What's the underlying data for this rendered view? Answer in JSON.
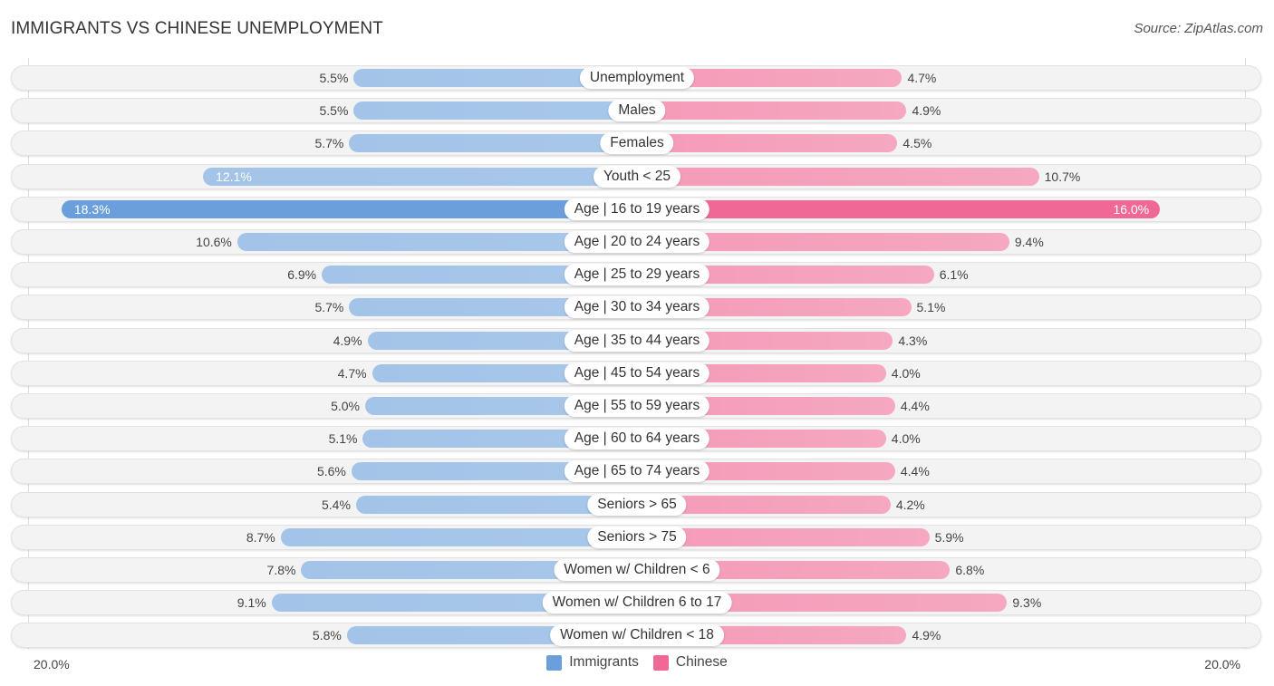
{
  "header": {
    "title": "IMMIGRANTS VS CHINESE UNEMPLOYMENT",
    "source": "Source: ZipAtlas.com"
  },
  "colors": {
    "immigrants": "#6a9fdc",
    "chinese": "#f06996",
    "immigrants_light": "#a5c5e9",
    "chinese_light": "#f5a3bd"
  },
  "chart_data": {
    "type": "bar",
    "orientation": "horizontal-diverging",
    "title": "IMMIGRANTS VS CHINESE UNEMPLOYMENT",
    "categories": [
      "Unemployment",
      "Males",
      "Females",
      "Youth < 25",
      "Age | 16 to 19 years",
      "Age | 20 to 24 years",
      "Age | 25 to 29 years",
      "Age | 30 to 34 years",
      "Age | 35 to 44 years",
      "Age | 45 to 54 years",
      "Age | 55 to 59 years",
      "Age | 60 to 64 years",
      "Age | 65 to 74 years",
      "Seniors > 65",
      "Seniors > 75",
      "Women w/ Children < 6",
      "Women w/ Children 6 to 17",
      "Women w/ Children < 18"
    ],
    "series": [
      {
        "name": "Immigrants",
        "side": "left",
        "values": [
          5.5,
          5.5,
          5.7,
          12.1,
          18.3,
          10.6,
          6.9,
          5.7,
          4.9,
          4.7,
          5.0,
          5.1,
          5.6,
          5.4,
          8.7,
          7.8,
          9.1,
          5.8
        ],
        "labels": [
          "5.5%",
          "5.5%",
          "5.7%",
          "12.1%",
          "18.3%",
          "10.6%",
          "6.9%",
          "5.7%",
          "4.9%",
          "4.7%",
          "5.0%",
          "5.1%",
          "5.6%",
          "5.4%",
          "8.7%",
          "7.8%",
          "9.1%",
          "5.8%"
        ]
      },
      {
        "name": "Chinese",
        "side": "right",
        "values": [
          4.7,
          4.9,
          4.5,
          10.7,
          16.0,
          9.4,
          6.1,
          5.1,
          4.3,
          4.0,
          4.4,
          4.0,
          4.4,
          4.2,
          5.9,
          6.8,
          9.3,
          4.9
        ],
        "labels": [
          "4.7%",
          "4.9%",
          "4.5%",
          "10.7%",
          "16.0%",
          "9.4%",
          "6.1%",
          "5.1%",
          "4.3%",
          "4.0%",
          "4.4%",
          "4.0%",
          "4.4%",
          "4.2%",
          "5.9%",
          "6.8%",
          "9.3%",
          "4.9%"
        ]
      }
    ],
    "xlim": [
      -20,
      20
    ],
    "axis_labels": {
      "left": "20.0%",
      "right": "20.0%"
    },
    "legend": {
      "position": "bottom-center",
      "entries": [
        "Immigrants",
        "Chinese"
      ]
    },
    "unit": "%"
  }
}
